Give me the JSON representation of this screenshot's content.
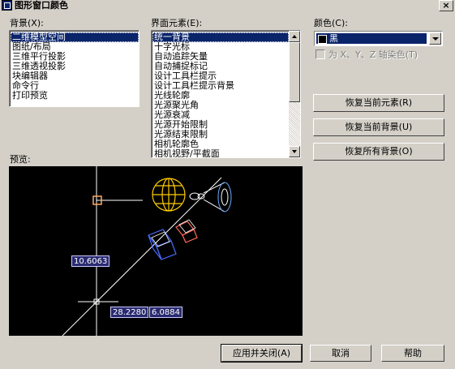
{
  "window": {
    "title": "图形窗口颜色"
  },
  "context": {
    "label": "背景(X):",
    "items": [
      "二维模型空间",
      "图纸/布局",
      "三维平行投影",
      "三维透视投影",
      "块编辑器",
      "命令行",
      "打印预览"
    ],
    "selected_index": 0
  },
  "element": {
    "label": "界面元素(E):",
    "items": [
      "统一背景",
      "十字光标",
      "自动追踪矢量",
      "自动捕捉标记",
      "设计工具栏提示",
      "设计工具栏提示背景",
      "光线轮廓",
      "光源聚光角",
      "光源衰减",
      "光源开始限制",
      "光源结束限制",
      "相机轮廓色",
      "相机视野/平截面"
    ],
    "selected_index": 0
  },
  "color": {
    "label": "颜色(C):",
    "value": "黑",
    "swatch_color": "#000000",
    "tint_checkbox_label": "为 X、Y、Z 轴染色(T)",
    "tint_checked": false,
    "tint_enabled": false
  },
  "buttons": {
    "restore_element": "恢复当前元素(R)",
    "restore_context": "恢复当前背景(U)",
    "restore_all": "恢复所有背景(O)",
    "apply_close": "应用并关闭(A)",
    "cancel": "取消",
    "help": "帮助"
  },
  "preview": {
    "label": "预览:",
    "dim_vertical": "10.6063",
    "dim_a": "28.2280",
    "dim_b": "6.0884"
  },
  "colors": {
    "selection": "#0a246a",
    "dialog_bg": "#d4d0c8",
    "preview_bg": "#000000"
  }
}
